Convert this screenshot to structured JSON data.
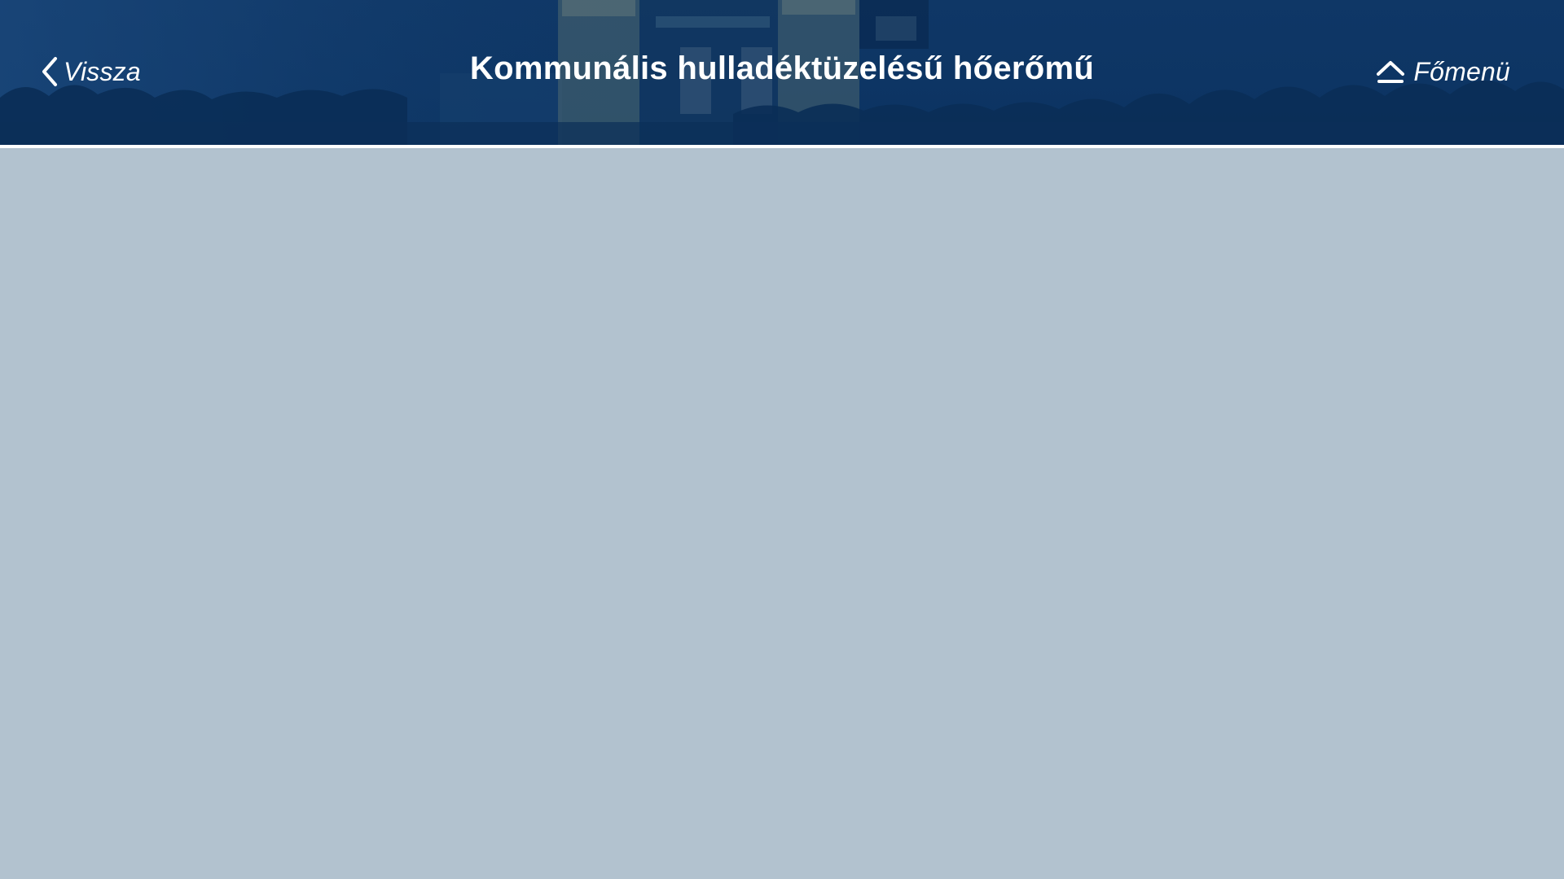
{
  "header": {
    "title": "Kommunális hulladéktüzelésű hőerőmű",
    "back_label": "Vissza",
    "back_icon": "chevron-left-icon",
    "home_label": "Főmenü",
    "home_icon": "eject-home-icon"
  },
  "colors": {
    "header_bg": "#0d3564",
    "content_bg": "#b2c2cf",
    "text": "#ffffff"
  }
}
